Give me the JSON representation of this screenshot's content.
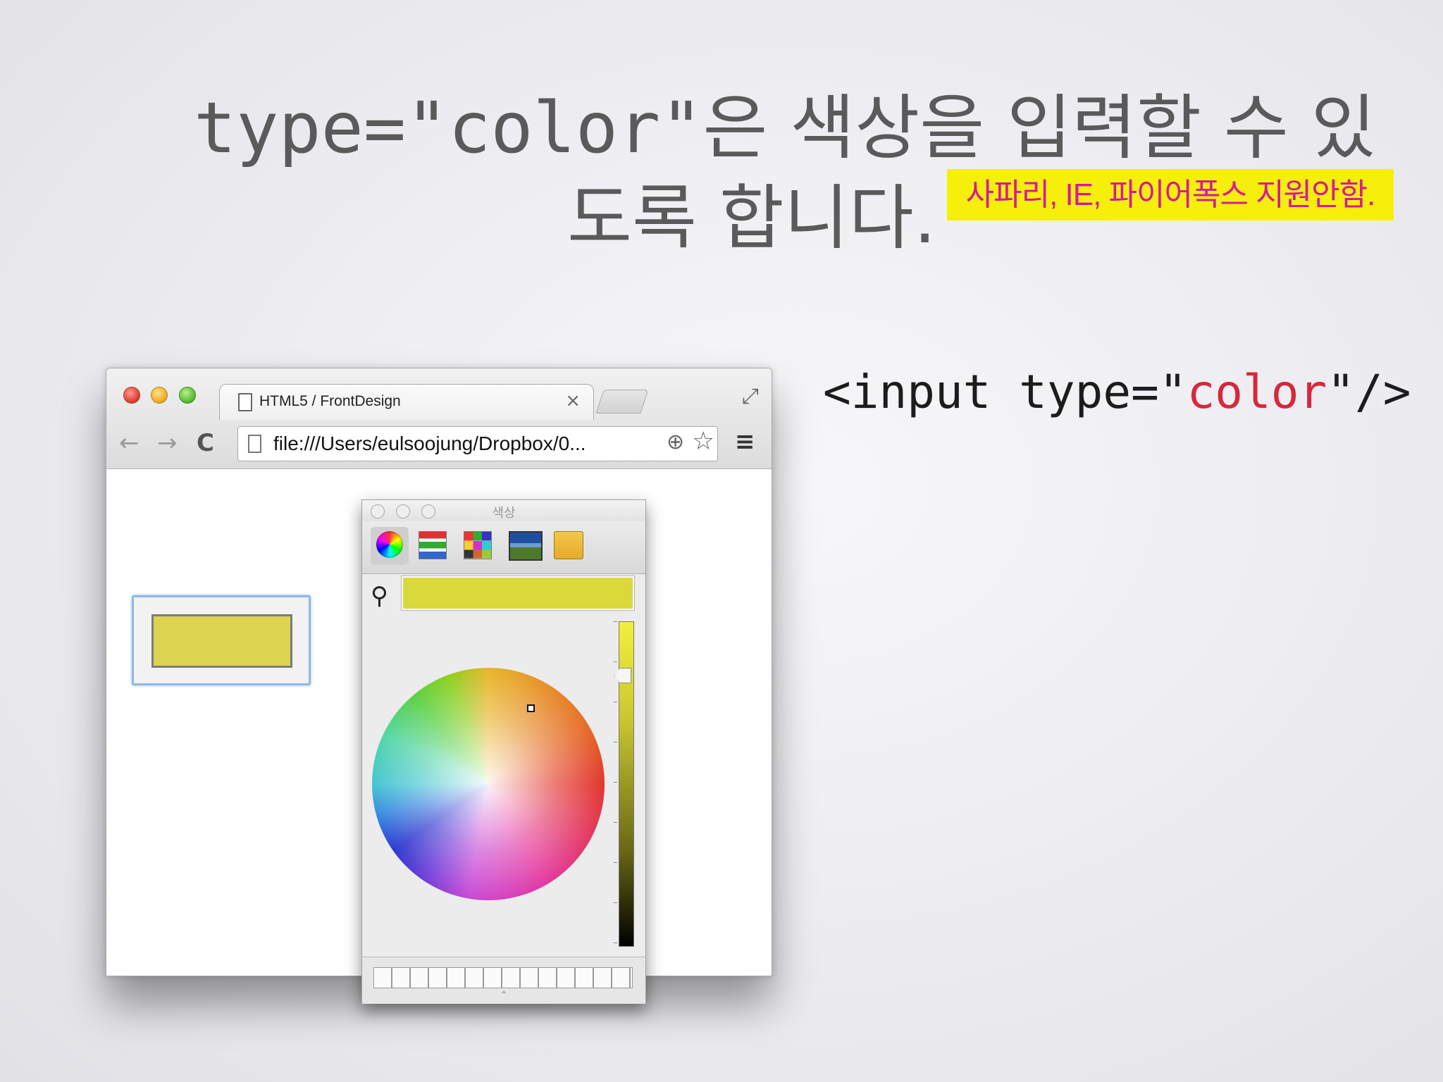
{
  "slide": {
    "title_code": "type=\"color\"",
    "title_rest_line1": "은 색상을 입력할 수 있",
    "title_line2": "도록 합니다.",
    "note": "사파리, IE, 파이어폭스 지원안함.",
    "code_prefix": "<input type=\"",
    "code_value": "color",
    "code_suffix": "\"/>"
  },
  "browser": {
    "tab_title": "HTML5 / FrontDesign",
    "tab_close": "×",
    "url": "file:///Users/eulsoojung/Dropbox/0...",
    "nav_back": "←",
    "nav_forward": "→",
    "reload": "C",
    "zoom_glyph": "⊕",
    "star_glyph": "☆",
    "menu_glyph": "≡",
    "fullscreen_glyph": "⤢"
  },
  "color_input": {
    "value_color": "#dcd350"
  },
  "color_picker": {
    "title": "색상",
    "current_color": "#d9d93c",
    "search_glyph": "⚲",
    "tools": [
      "color-wheel",
      "color-sliders",
      "color-palettes",
      "image-palettes",
      "crayons"
    ]
  }
}
